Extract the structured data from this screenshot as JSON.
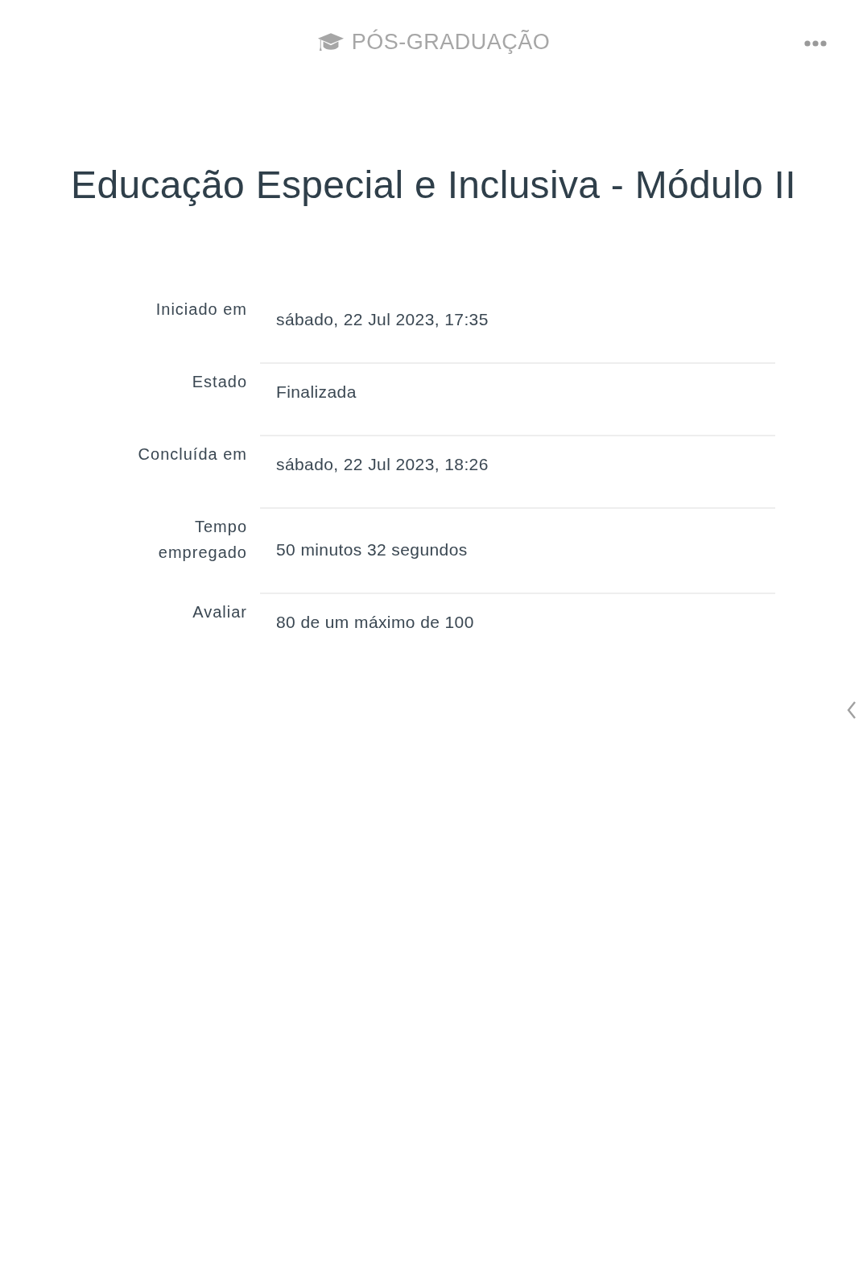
{
  "header": {
    "brand": "PÓS-GRADUAÇÃO"
  },
  "title": "Educação Especial e Inclusiva - Módulo II",
  "summary": [
    {
      "label": "Iniciado em",
      "value": "sábado, 22 Jul 2023, 17:35"
    },
    {
      "label": "Estado",
      "value": "Finalizada"
    },
    {
      "label": "Concluída em",
      "value": "sábado, 22 Jul 2023, 18:26"
    },
    {
      "label": "Tempo empregado",
      "value": "50 minutos 32 segundos"
    },
    {
      "label": "Avaliar",
      "value": "80 de um máximo de 100"
    }
  ]
}
